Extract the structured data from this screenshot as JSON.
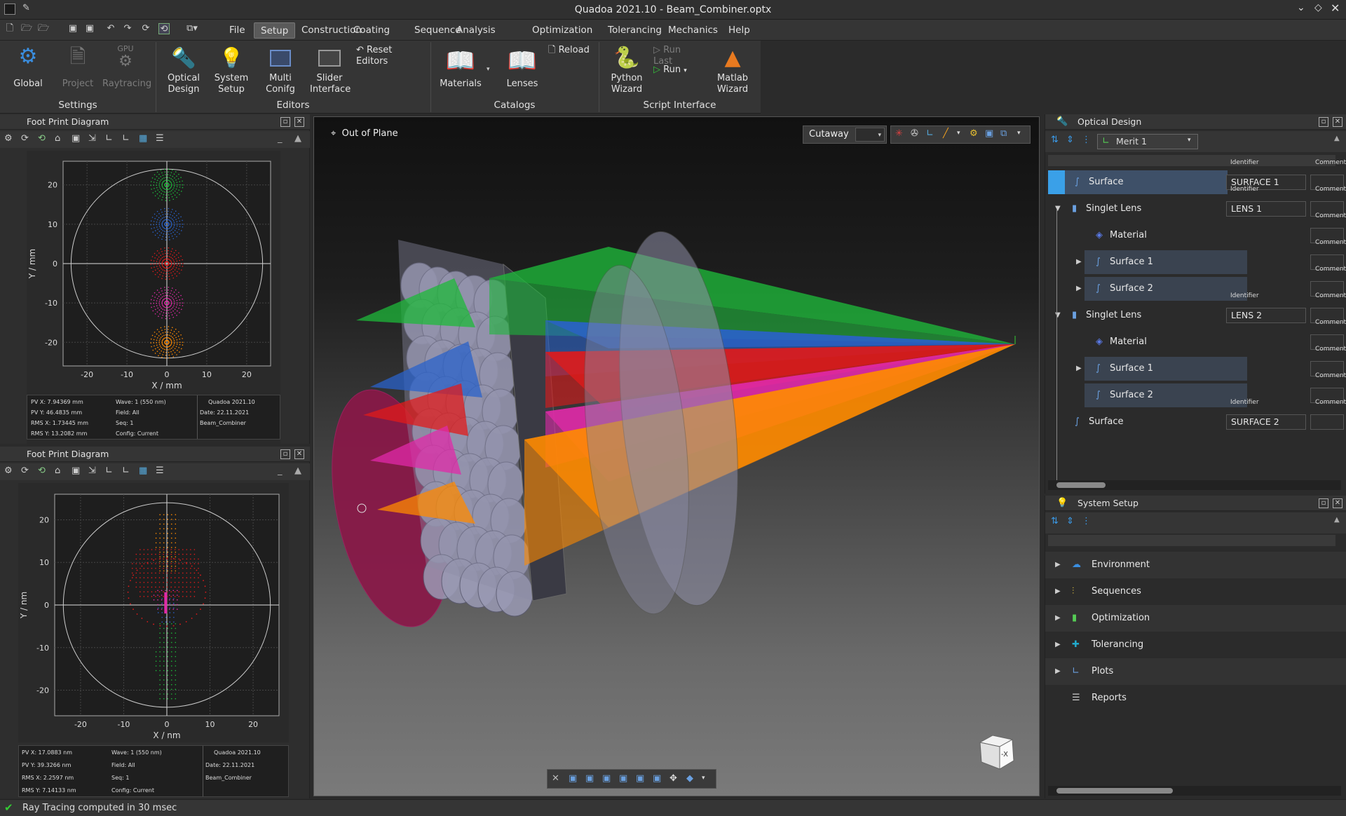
{
  "window": {
    "title": "Quadoa 2021.10 - Beam_Combiner.optx"
  },
  "menu": {
    "items": [
      "File",
      "Setup",
      "Construction",
      "Coating",
      "Sequence",
      "Analysis",
      "Optimization",
      "Tolerancing",
      "Mechanics",
      "Help"
    ],
    "active": "Setup"
  },
  "ribbon": {
    "settings": {
      "label": "Settings",
      "global": "Global",
      "project": "Project",
      "raytracing": "Raytracing",
      "gpu": "GPU"
    },
    "editors": {
      "label": "Editors",
      "optical": "Optical\nDesign",
      "system": "System\nSetup",
      "multi": "Multi\nConifg",
      "slider": "Slider\nInterface",
      "reset": "Reset Editors"
    },
    "catalogs": {
      "label": "Catalogs",
      "materials": "Materials",
      "lenses": "Lenses",
      "reload": "Reload"
    },
    "script": {
      "label": "Script Interface",
      "python": "Python\nWizard",
      "run_last": "Run Last",
      "run": "Run",
      "matlab": "Matlab\nWizard"
    }
  },
  "footprint1": {
    "title": "Foot Print Diagram",
    "xlabel": "X / mm",
    "ylabel": "Y / mm",
    "xticks": [
      "-20",
      "-10",
      "0",
      "10",
      "20"
    ],
    "yticks": [
      "20",
      "10",
      "0",
      "-10",
      "-20"
    ],
    "info": {
      "pvx": "PV X: 7.94369 mm",
      "pvy": "PV Y: 46.4835 mm",
      "rmsx": "RMS X: 1.73445 mm",
      "rmsy": "RMS Y: 13.2082 mm",
      "wave": "Wave: 1 (550 nm)",
      "field": "Field: All",
      "seq": "Seq: 1",
      "config": "Config: Current",
      "app": "Quadoa 2021.10",
      "date": "Date: 22.11.2021",
      "file": "Beam_Combiner"
    }
  },
  "footprint2": {
    "title": "Foot Print Diagram",
    "xlabel": "X / nm",
    "ylabel": "Y / nm",
    "xticks": [
      "-20",
      "-10",
      "0",
      "10",
      "20"
    ],
    "yticks": [
      "20",
      "10",
      "0",
      "-10",
      "-20"
    ],
    "info": {
      "pvx": "PV X: 17.0883 nm",
      "pvy": "PV Y: 39.3266 nm",
      "rmsx": "RMS X: 2.2597 nm",
      "rmsy": "RMS Y: 7.14133 nm",
      "wave": "Wave: 1 (550 nm)",
      "field": "Field: All",
      "seq": "Seq: 1",
      "config": "Config: Current",
      "app": "Quadoa 2021.10",
      "date": "Date: 22.11.2021",
      "file": "Beam_Combiner"
    }
  },
  "viewport": {
    "plane_label": "Out of Plane",
    "cutaway": "Cutaway",
    "cube_label": "-X"
  },
  "optical_design": {
    "title": "Optical Design",
    "merit": "Merit 1",
    "hdr_identifier": "Identifier",
    "hdr_comment": "Comment",
    "rows": [
      {
        "label": "Surface",
        "id": "SURFACE 1"
      },
      {
        "label": "Singlet Lens",
        "id": "LENS 1"
      },
      {
        "label": "Material",
        "id": ""
      },
      {
        "label": "Surface 1",
        "id": ""
      },
      {
        "label": "Surface 2",
        "id": ""
      },
      {
        "label": "Singlet Lens",
        "id": "LENS 2"
      },
      {
        "label": "Material",
        "id": ""
      },
      {
        "label": "Surface 1",
        "id": ""
      },
      {
        "label": "Surface 2",
        "id": ""
      },
      {
        "label": "Surface",
        "id": "SURFACE 2"
      }
    ]
  },
  "system_setup": {
    "title": "System Setup",
    "items": [
      "Environment",
      "Sequences",
      "Optimization",
      "Tolerancing",
      "Plots",
      "Reports"
    ]
  },
  "status": {
    "text": "Ray Tracing computed in 30 msec"
  },
  "colors": {
    "green": "#1db83a",
    "blue": "#2a62c9",
    "red": "#e01b1b",
    "magenta": "#e02aa8",
    "orange": "#ff8a00",
    "accent": "#3aa0e8"
  }
}
